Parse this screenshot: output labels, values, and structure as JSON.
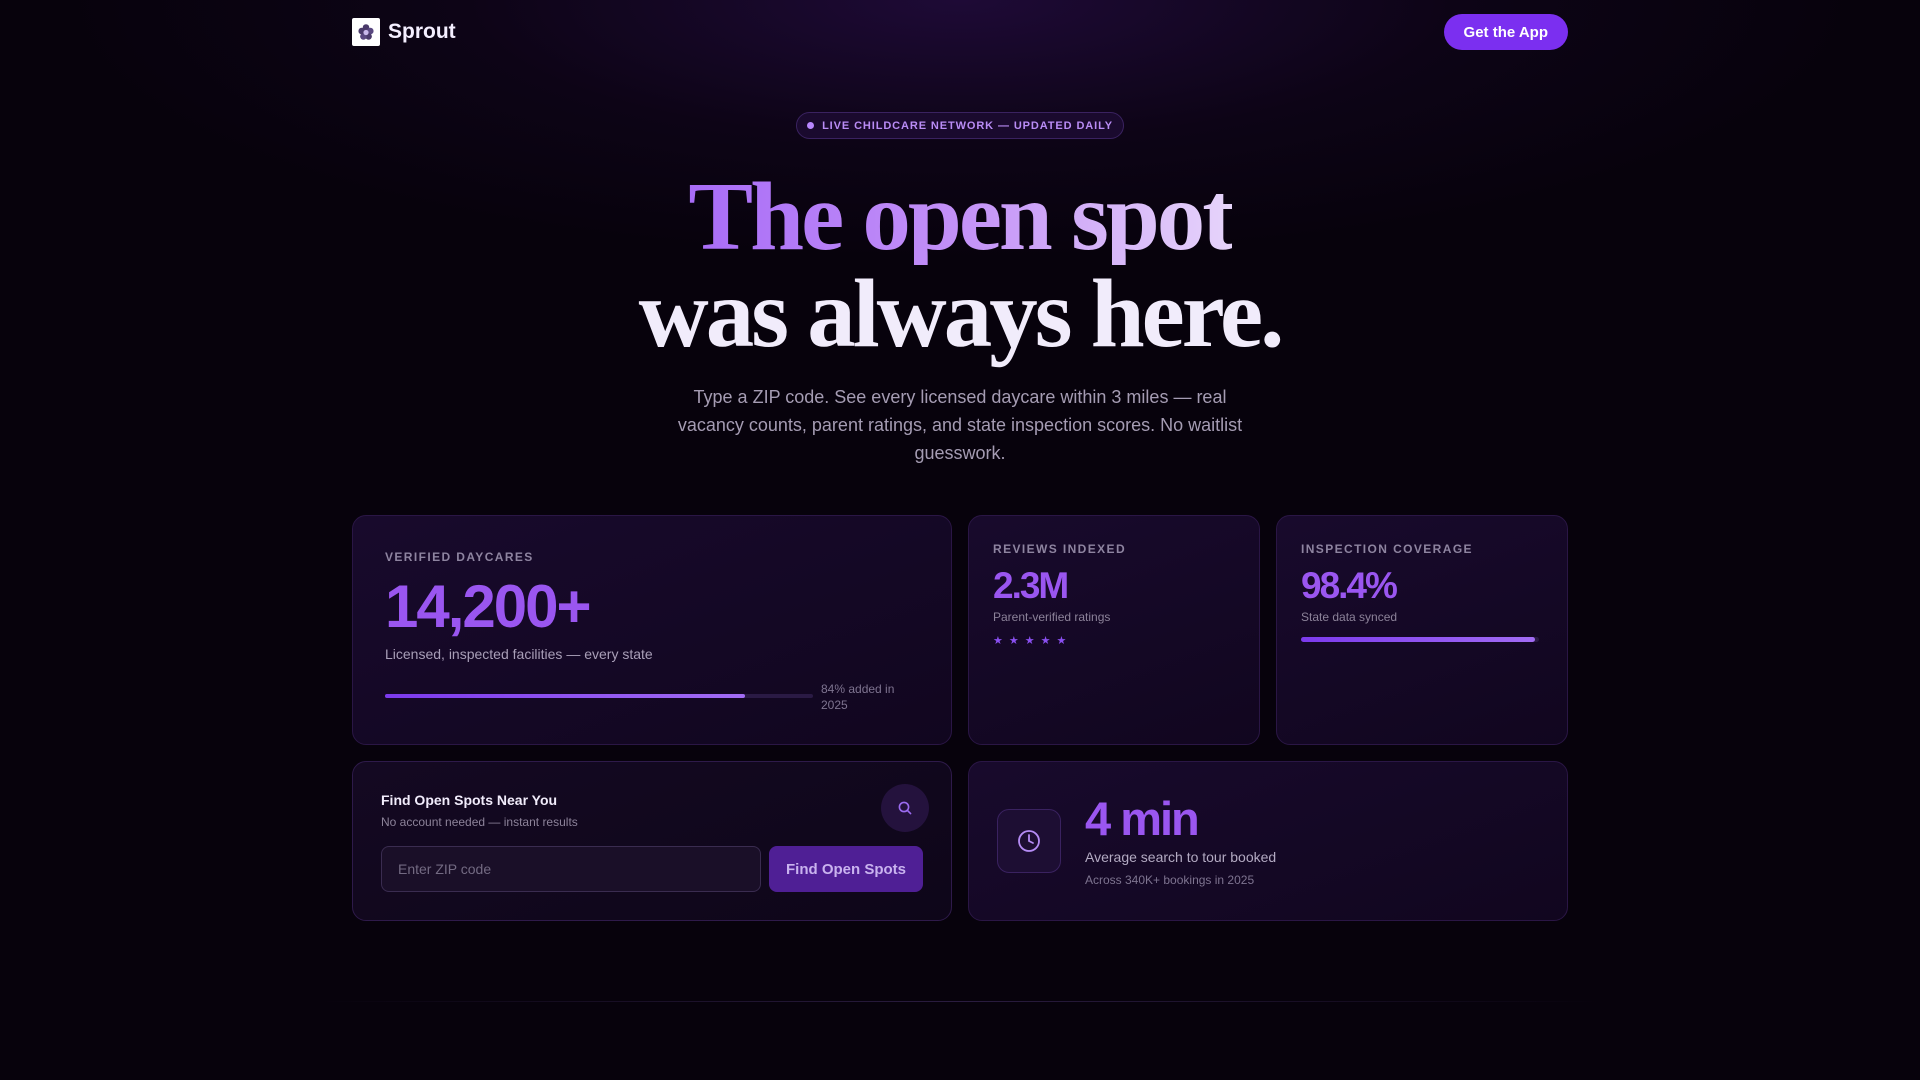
{
  "nav": {
    "brand": "Sprout",
    "logo_icon": "flower-logo-icon",
    "cta_label": "Get the App"
  },
  "badge": {
    "text": "LIVE CHILDCARE NETWORK — UPDATED DAILY"
  },
  "hero": {
    "line1": "The open spot",
    "line2": "was always here.",
    "subtitle": "Type a ZIP code. See every licensed daycare within 3 miles — real vacancy counts, parent ratings, and state inspection scores. No waitlist guesswork."
  },
  "stats": {
    "daycares": {
      "eyebrow": "VERIFIED DAYCARES",
      "value": "14,200+",
      "description": "Licensed, inspected facilities — every state",
      "bar_label": "84% added in 2025",
      "progress": 0.84
    },
    "reviews": {
      "eyebrow": "REVIEWS INDEXED",
      "value": "2.3M",
      "description": "Parent-verified ratings",
      "stars": [
        "★",
        "★",
        "★",
        "★",
        "★"
      ]
    },
    "inspection": {
      "eyebrow": "INSPECTION COVERAGE",
      "value": "98.4%",
      "description": "State data synced",
      "progress": 0.984
    }
  },
  "search": {
    "title": "Find Open Spots Near You",
    "subtitle": "No account needed — instant results",
    "placeholder": "Enter ZIP code",
    "value": "",
    "button_label": "Find Open Spots",
    "icon": "search-icon"
  },
  "timing": {
    "value": "4 min",
    "description": "Average search to tour booked",
    "subtext": "Across 340K+ bookings in 2025",
    "icon": "clock-icon"
  },
  "colors": {
    "accent": "#7b2ff0",
    "stat": "#9a56f0",
    "background": "#07020c"
  }
}
